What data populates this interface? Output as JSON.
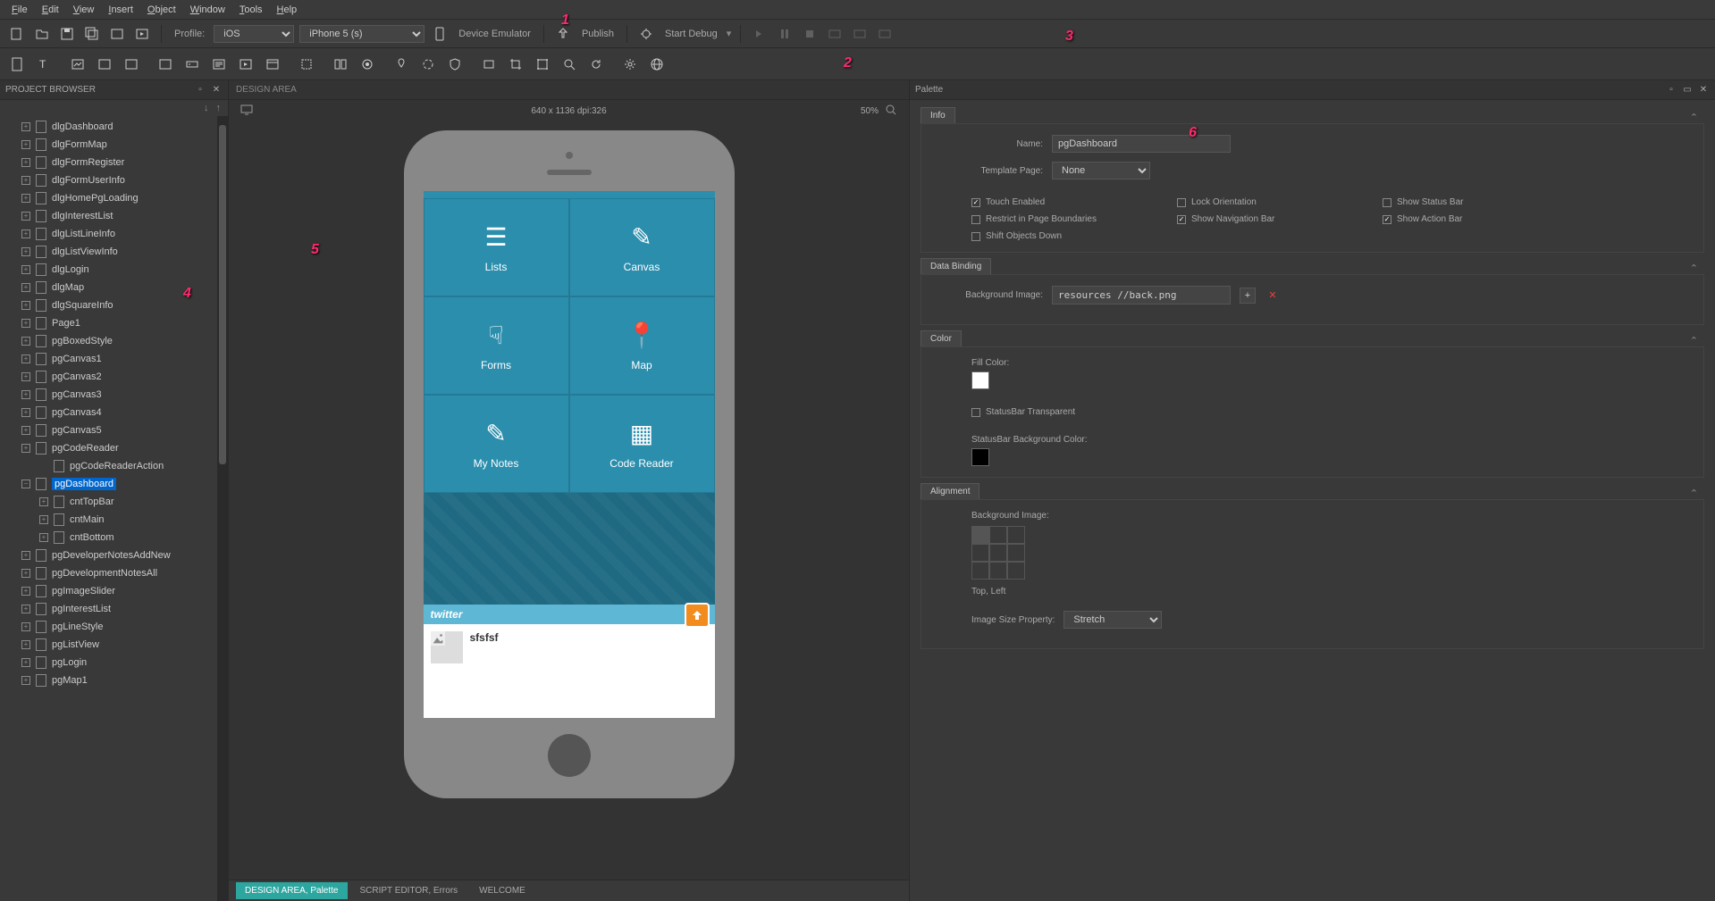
{
  "menubar": [
    "File",
    "Edit",
    "View",
    "Insert",
    "Object",
    "Window",
    "Tools",
    "Help"
  ],
  "toolbar": {
    "profile_label": "Profile:",
    "profile_value": "iOS",
    "device_value": "iPhone 5 (s)",
    "device_emulator": "Device Emulator",
    "publish": "Publish",
    "start_debug": "Start Debug"
  },
  "annotations": [
    "1",
    "2",
    "3",
    "4",
    "5",
    "6"
  ],
  "project_browser": {
    "title": "PROJECT BROWSER",
    "items": [
      {
        "name": "dlgDashboard",
        "level": 0,
        "expand": "+"
      },
      {
        "name": "dlgFormMap",
        "level": 0,
        "expand": "+"
      },
      {
        "name": "dlgFormRegister",
        "level": 0,
        "expand": "+"
      },
      {
        "name": "dlgFormUserInfo",
        "level": 0,
        "expand": "+"
      },
      {
        "name": "dlgHomePgLoading",
        "level": 0,
        "expand": "+"
      },
      {
        "name": "dlgInterestList",
        "level": 0,
        "expand": "+"
      },
      {
        "name": "dlgListLineInfo",
        "level": 0,
        "expand": "+"
      },
      {
        "name": "dlgListViewInfo",
        "level": 0,
        "expand": "+"
      },
      {
        "name": "dlgLogin",
        "level": 0,
        "expand": "+"
      },
      {
        "name": "dlgMap",
        "level": 0,
        "expand": "+"
      },
      {
        "name": "dlgSquareInfo",
        "level": 0,
        "expand": "+"
      },
      {
        "name": "Page1",
        "level": 0,
        "expand": "+"
      },
      {
        "name": "pgBoxedStyle",
        "level": 0,
        "expand": "+"
      },
      {
        "name": "pgCanvas1",
        "level": 0,
        "expand": "+"
      },
      {
        "name": "pgCanvas2",
        "level": 0,
        "expand": "+"
      },
      {
        "name": "pgCanvas3",
        "level": 0,
        "expand": "+"
      },
      {
        "name": "pgCanvas4",
        "level": 0,
        "expand": "+"
      },
      {
        "name": "pgCanvas5",
        "level": 0,
        "expand": "+"
      },
      {
        "name": "pgCodeReader",
        "level": 0,
        "expand": "+"
      },
      {
        "name": "pgCodeReaderAction",
        "level": 1,
        "expand": ""
      },
      {
        "name": "pgDashboard",
        "level": 0,
        "expand": "−",
        "selected": true
      },
      {
        "name": "cntTopBar",
        "level": 1,
        "expand": "+"
      },
      {
        "name": "cntMain",
        "level": 1,
        "expand": "+"
      },
      {
        "name": "cntBottom",
        "level": 1,
        "expand": "+"
      },
      {
        "name": "pgDeveloperNotesAddNew",
        "level": 0,
        "expand": "+"
      },
      {
        "name": "pgDevelopmentNotesAll",
        "level": 0,
        "expand": "+"
      },
      {
        "name": "pgImageSlider",
        "level": 0,
        "expand": "+"
      },
      {
        "name": "pgInterestList",
        "level": 0,
        "expand": "+"
      },
      {
        "name": "pgLineStyle",
        "level": 0,
        "expand": "+"
      },
      {
        "name": "pgListView",
        "level": 0,
        "expand": "+"
      },
      {
        "name": "pgLogin",
        "level": 0,
        "expand": "+"
      },
      {
        "name": "pgMap1",
        "level": 0,
        "expand": "+"
      }
    ]
  },
  "design_area": {
    "title": "DESIGN AREA",
    "dimensions": "640 x 1136 dpi:326",
    "zoom": "50%",
    "tiles": [
      {
        "label": "Lists",
        "icon": "☰"
      },
      {
        "label": "Canvas",
        "icon": "✎"
      },
      {
        "label": "Forms",
        "icon": "☟"
      },
      {
        "label": "Map",
        "icon": "📍"
      },
      {
        "label": "My Notes",
        "icon": "✎"
      },
      {
        "label": "Code Reader",
        "icon": "▦"
      }
    ],
    "twitter_label": "twitter",
    "tweet_text": "sfsfsf"
  },
  "palette": {
    "title": "Palette",
    "info_tab": "Info",
    "name_label": "Name:",
    "name_value": "pgDashboard",
    "template_label": "Template Page:",
    "template_value": "None",
    "checks": [
      {
        "label": "Touch Enabled",
        "checked": true
      },
      {
        "label": "Lock Orientation",
        "checked": false
      },
      {
        "label": "Show Status Bar",
        "checked": false
      },
      {
        "label": "Restrict in Page Boundaries",
        "checked": false
      },
      {
        "label": "Show Navigation Bar",
        "checked": true
      },
      {
        "label": "Show Action Bar",
        "checked": true
      },
      {
        "label": "Shift Objects Down",
        "checked": false
      }
    ],
    "databinding_tab": "Data Binding",
    "bg_image_label": "Background Image:",
    "bg_image_value": "resources //back.png",
    "color_tab": "Color",
    "fill_color_label": "Fill Color:",
    "fill_color": "#ffffff",
    "statusbar_transparent": "StatusBar Transparent",
    "statusbar_bg_label": "StatusBar Background Color:",
    "statusbar_bg_color": "#000000",
    "alignment_tab": "Alignment",
    "align_bg_label": "Background Image:",
    "align_position": "Top, Left",
    "image_size_label": "Image Size Property:",
    "image_size_value": "Stretch"
  },
  "bottom_tabs": [
    {
      "label": "DESIGN AREA, Palette",
      "active": true
    },
    {
      "label": "SCRIPT EDITOR, Errors",
      "active": false
    },
    {
      "label": "WELCOME",
      "active": false
    }
  ]
}
